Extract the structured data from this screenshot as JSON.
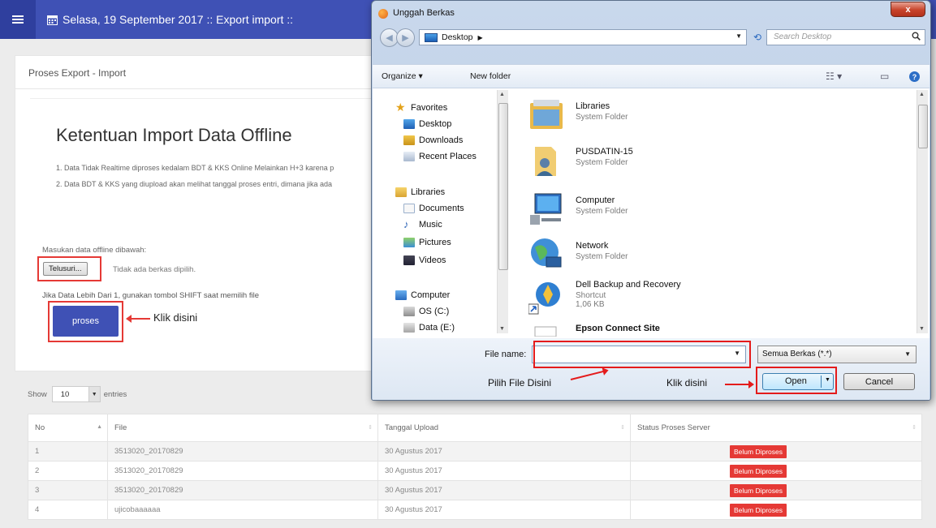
{
  "app": {
    "header_text": "Selasa, 19 September 2017 :: Export import ::",
    "colors": {
      "primary": "#3f51b5",
      "danger": "#e53935"
    }
  },
  "page": {
    "heading": "Proses Export - Import",
    "card_title": "Ketentuan Import Data Offline",
    "rule_1": "1. Data Tidak Realtime diproses kedalam BDT & KKS Online Melainkan H+3 karena p",
    "rule_2": "2. Data BDT & KKS yang diupload akan melihat tanggal proses entri, dimana jika ada",
    "upload_label": "Masukan data offline dibawah:",
    "browse_label": "Telusuri...",
    "no_file_text": "Tidak ada berkas dipilih.",
    "shift_note": "Jika Data Lebih Dari 1, gunakan tombol SHIFT saat memilih file",
    "proses_label": "proses",
    "annotation_click_here": "Klik disini"
  },
  "table": {
    "show_label": "Show",
    "entries_value": "10",
    "entries_label": "entries",
    "columns": [
      "No",
      "File",
      "Tanggal Upload",
      "Status Proses Server"
    ],
    "rows": [
      {
        "no": "1",
        "file": "3513020_20170829",
        "date": "30 Agustus 2017",
        "status": "Belum Diproses"
      },
      {
        "no": "2",
        "file": "3513020_20170829",
        "date": "30 Agustus 2017",
        "status": "Belum Diproses"
      },
      {
        "no": "3",
        "file": "3513020_20170829",
        "date": "30 Agustus 2017",
        "status": "Belum Diproses"
      },
      {
        "no": "4",
        "file": "ujicobaaaaaa",
        "date": "30 Agustus 2017",
        "status": "Belum Diproses"
      }
    ]
  },
  "dialog": {
    "title": "Unggah Berkas",
    "close_label": "x",
    "address": "Desktop",
    "search_placeholder": "Search Desktop",
    "toolbar": {
      "organize": "Organize ▾",
      "new_folder": "New folder"
    },
    "nav_items": [
      {
        "label": "Favorites",
        "icon": "star-icon"
      },
      {
        "label": "Desktop",
        "icon": "desktop-icon"
      },
      {
        "label": "Downloads",
        "icon": "downloads-icon"
      },
      {
        "label": "Recent Places",
        "icon": "recent-places-icon"
      },
      {
        "label": "Libraries",
        "icon": "libraries-icon"
      },
      {
        "label": "Documents",
        "icon": "documents-icon"
      },
      {
        "label": "Music",
        "icon": "music-icon"
      },
      {
        "label": "Pictures",
        "icon": "pictures-icon"
      },
      {
        "label": "Videos",
        "icon": "videos-icon"
      },
      {
        "label": "Computer",
        "icon": "computer-icon"
      },
      {
        "label": "OS (C:)",
        "icon": "drive-icon"
      },
      {
        "label": "Data (E:)",
        "icon": "drive-icon"
      }
    ],
    "items": [
      {
        "name": "Libraries",
        "sub": "System Folder",
        "icon": "libraries-folder-icon"
      },
      {
        "name": "PUSDATIN-15",
        "sub": "System Folder",
        "icon": "user-folder-icon"
      },
      {
        "name": "Computer",
        "sub": "System Folder",
        "icon": "computer-icon"
      },
      {
        "name": "Network",
        "sub": "System Folder",
        "icon": "network-icon"
      },
      {
        "name": "Dell Backup and Recovery",
        "sub": "Shortcut",
        "sub2": "1,06 KB",
        "icon": "shortcut-icon"
      },
      {
        "name": "Epson Connect Site",
        "sub": "",
        "icon": "document-icon"
      }
    ],
    "file_name_label": "File name:",
    "file_name_value": "",
    "filter_value": "Semua Berkas (*.*)",
    "open_label": "Open",
    "cancel_label": "Cancel",
    "annotation_pick_file": "Pilih File Disini",
    "annotation_click_here": "Klik disini"
  }
}
